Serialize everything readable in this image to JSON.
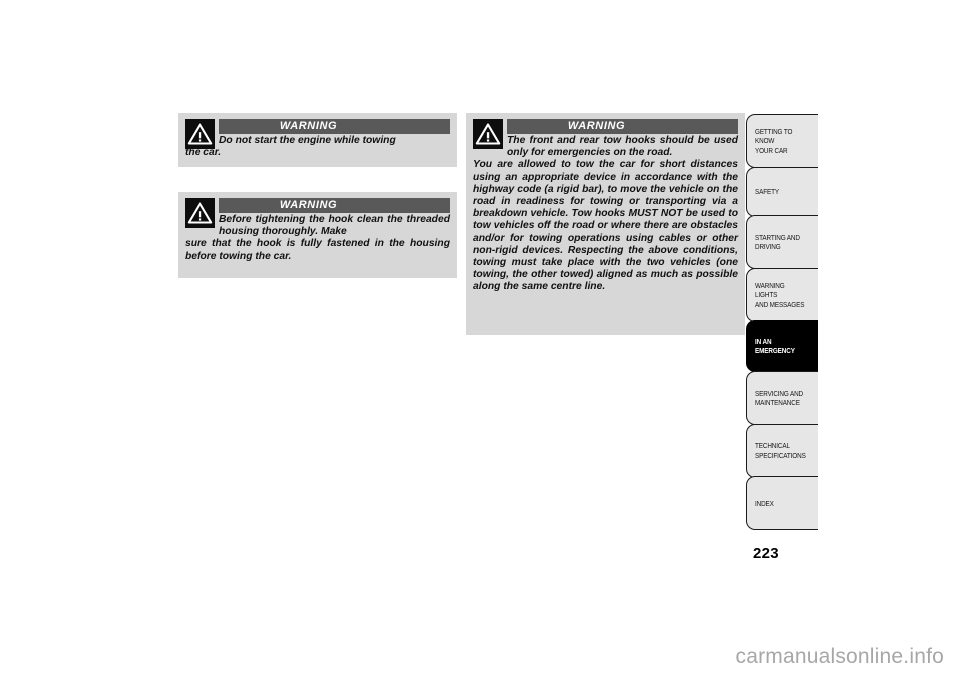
{
  "page": {
    "number": "223",
    "watermark": "carmanualsonline.info",
    "background_color": "#ffffff"
  },
  "colors": {
    "warning_box_bg": "#d7d7d7",
    "warning_header_bg": "#595959",
    "warning_header_text": "#ffffff",
    "icon_bg": "#0d0d0d",
    "tab_bg": "#e6e6e6",
    "tab_active_bg": "#000000",
    "tab_border": "#1a1a1a",
    "watermark_text": "#a7a7a7"
  },
  "warnings": [
    {
      "id": "warning-do-not-start-engine",
      "header": "WARNING",
      "icon": "warning-triangle-icon",
      "indented_text": "Do not start the engine while towing",
      "body_text": "the car.",
      "full_text": "Do not start the engine while towing the car."
    },
    {
      "id": "warning-tighten-hook",
      "header": "WARNING",
      "icon": "warning-triangle-icon",
      "indented_text": "Before tightening the hook clean the threaded housing thoroughly. Make",
      "body_text": "sure that the hook is fully fastened in the housing before towing the car.",
      "full_text": "Before tightening the hook clean the threaded housing thoroughly. Make sure that the hook is fully fastened in the housing before towing the car."
    },
    {
      "id": "warning-tow-hooks-usage",
      "header": "WARNING",
      "icon": "warning-triangle-icon",
      "indented_text": "The front and rear tow hooks should be used only for emergencies on the road.",
      "body_text": "You are allowed to tow the car for short distances using an appropriate device in accordance with the highway code (a rigid bar), to move the vehicle on the road in readiness for towing or transporting via a breakdown vehicle. Tow hooks MUST NOT be used to tow vehicles off the road or where there are obstacles and/or for towing operations using cables or other non-rigid devices. Respecting the above conditions, towing must take place with the two vehicles (one towing, the other towed) aligned as much as possible along the same centre line.",
      "full_text": "The front and rear tow hooks should be used only for emergencies on the road. You are allowed to tow the car for short distances using an appropriate device in accordance with the highway code (a rigid bar), to move the vehicle on the road in readiness for towing or transporting via a breakdown vehicle. Tow hooks MUST NOT be used to tow vehicles off the road or where there are obstacles and/or for towing operations using cables or other non-rigid devices. Respecting the above conditions, towing must take place with the two vehicles (one towing, the other towed) aligned as much as possible along the same centre line."
    }
  ],
  "sidebar": {
    "active_index": 4,
    "tabs": [
      {
        "label": "GETTING TO KNOW\nYOUR CAR",
        "active": false
      },
      {
        "label": "SAFETY",
        "active": false
      },
      {
        "label": "STARTING AND\nDRIVING",
        "active": false
      },
      {
        "label": "WARNING LIGHTS\nAND MESSAGES",
        "active": false
      },
      {
        "label": "IN AN\nEMERGENCY",
        "active": true
      },
      {
        "label": "SERVICING AND\nMAINTENANCE",
        "active": false
      },
      {
        "label": "TECHNICAL\nSPECIFICATIONS",
        "active": false
      },
      {
        "label": "INDEX",
        "active": false
      }
    ]
  }
}
